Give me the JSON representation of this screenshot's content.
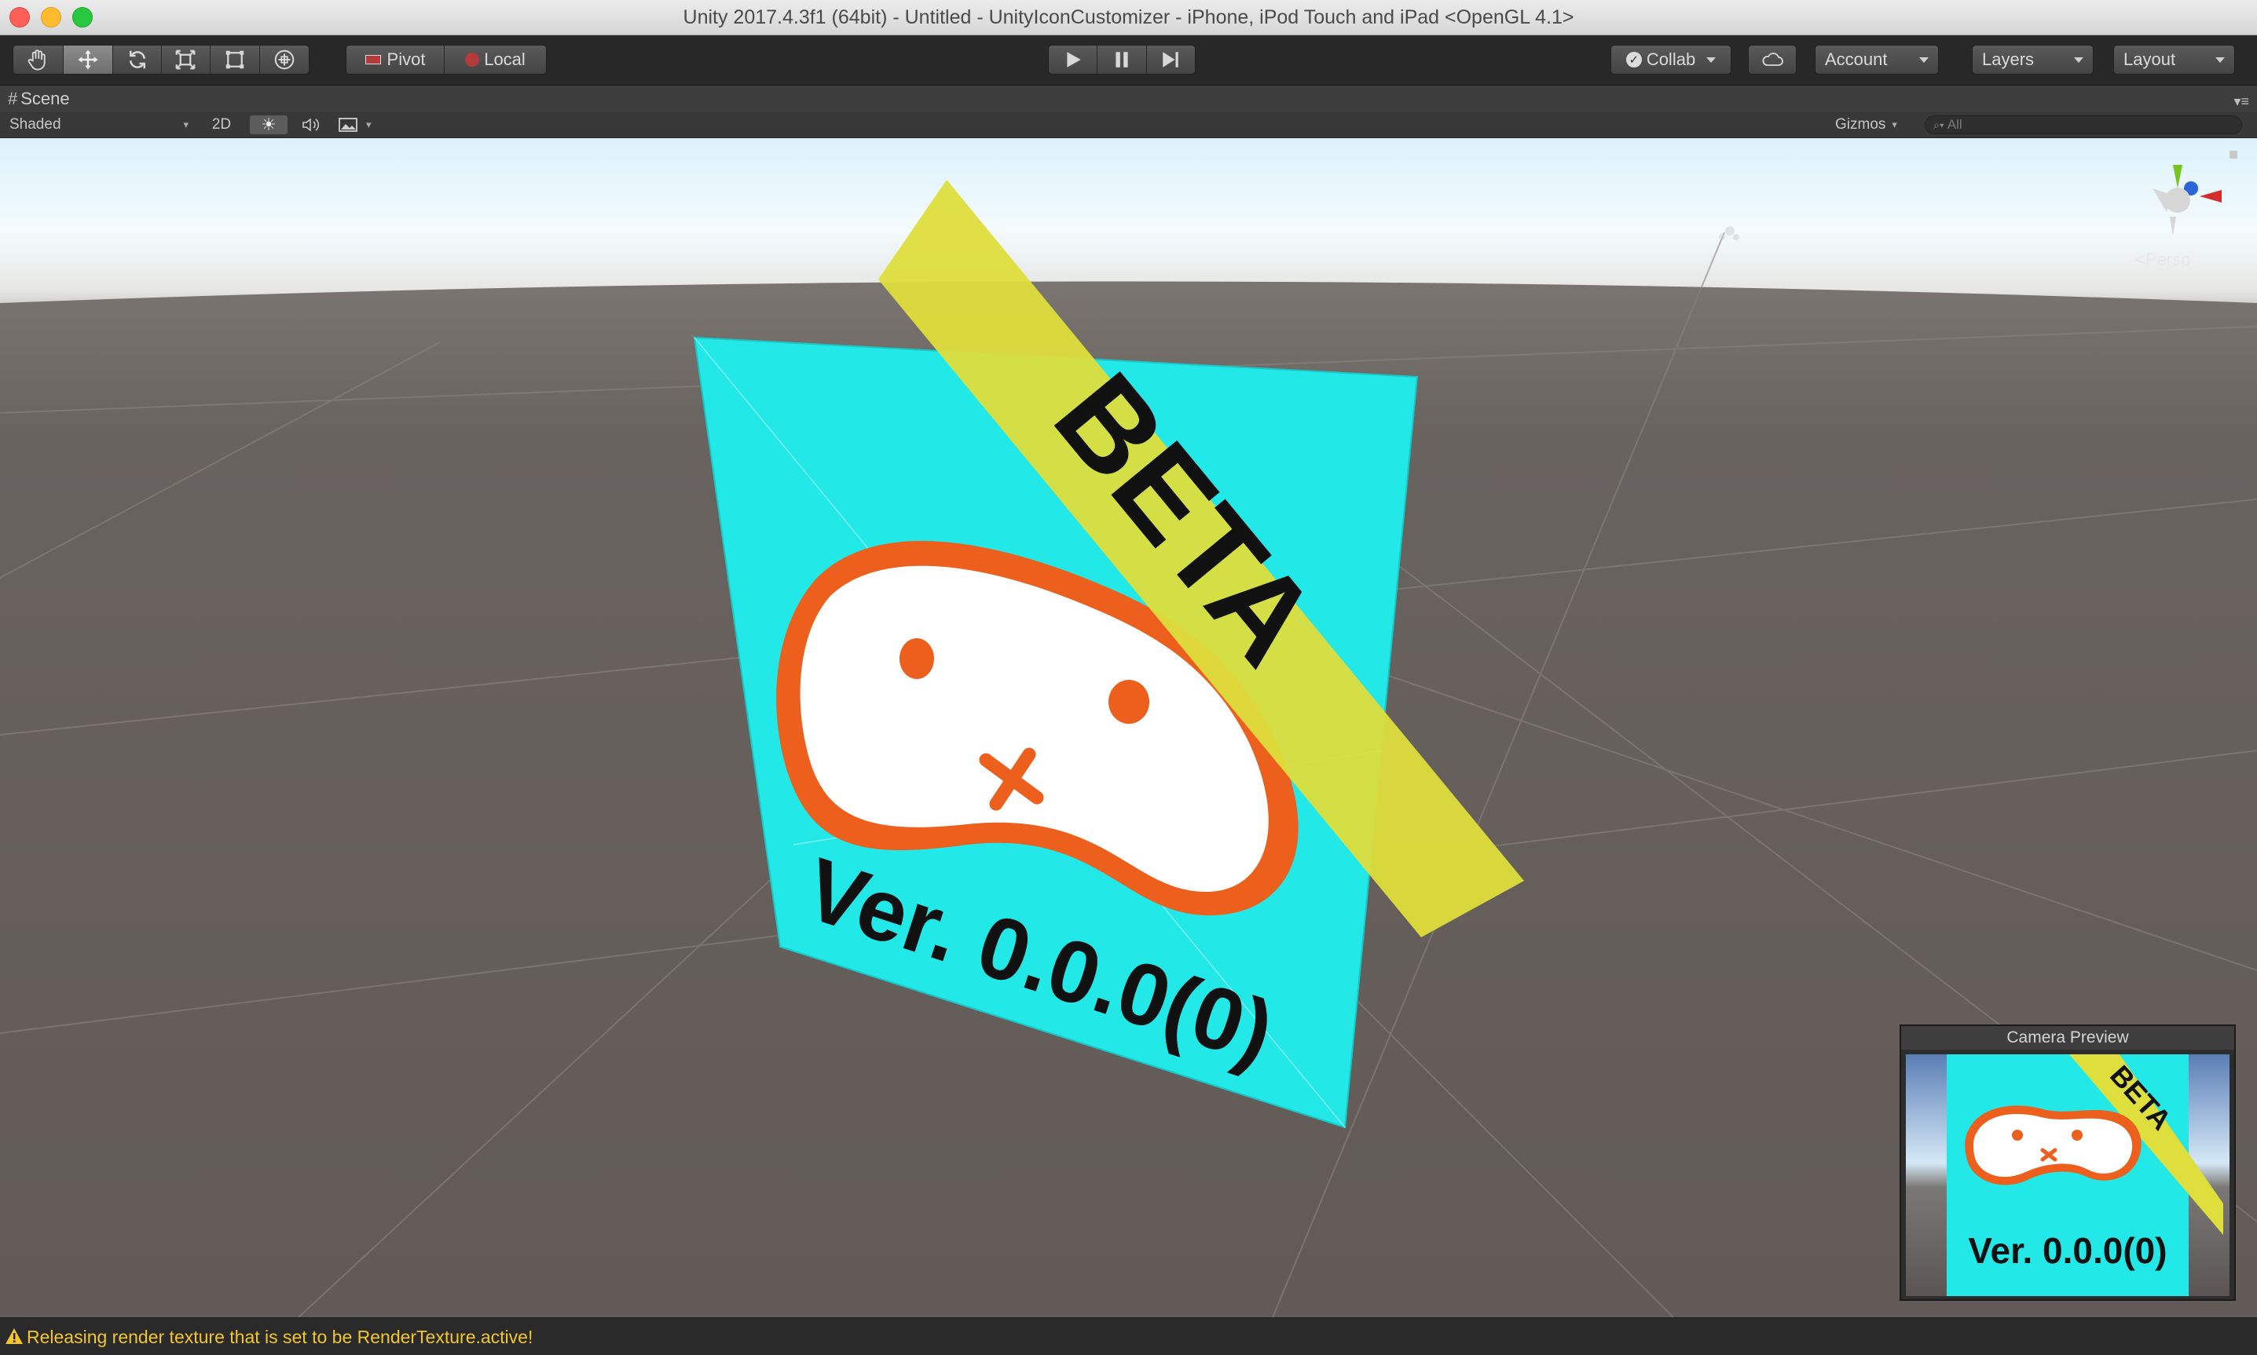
{
  "window": {
    "title": "Unity 2017.4.3f1 (64bit) - Untitled - UnityIconCustomizer - iPhone, iPod Touch and iPad <OpenGL 4.1>"
  },
  "toolbar": {
    "pivot_label": "Pivot",
    "local_label": "Local",
    "collab_label": "Collab",
    "account_label": "Account",
    "layers_label": "Layers",
    "layout_label": "Layout"
  },
  "scene_tab": {
    "label": "Scene",
    "shading_mode": "Shaded",
    "mode_2d": "2D",
    "gizmos_label": "Gizmos",
    "search_placeholder": "All",
    "projection_label": "Persp"
  },
  "icon": {
    "banner_text": "BETA",
    "version_text": "Ver. 0.0.0(0)"
  },
  "camera_preview": {
    "title": "Camera Preview",
    "banner_text": "BETA",
    "version_text": "Ver. 0.0.0(0)"
  },
  "status": {
    "message": "Releasing render texture that is set to be RenderTexture.active!"
  },
  "colors": {
    "icon_bg": "#22e8e8",
    "banner": "#dede3c",
    "mascot_outline": "#ec5f1d",
    "ground": "#655e59",
    "warning": "#f2c52e"
  },
  "icons": [
    "hand-icon",
    "move-icon",
    "rotate-icon",
    "scale-icon",
    "rect-icon",
    "transform-icon",
    "play-icon",
    "pause-icon",
    "step-icon",
    "cloud-icon",
    "sun-icon",
    "audio-icon",
    "image-icon",
    "warning-icon",
    "search-icon",
    "scene-gizmo-icon"
  ]
}
